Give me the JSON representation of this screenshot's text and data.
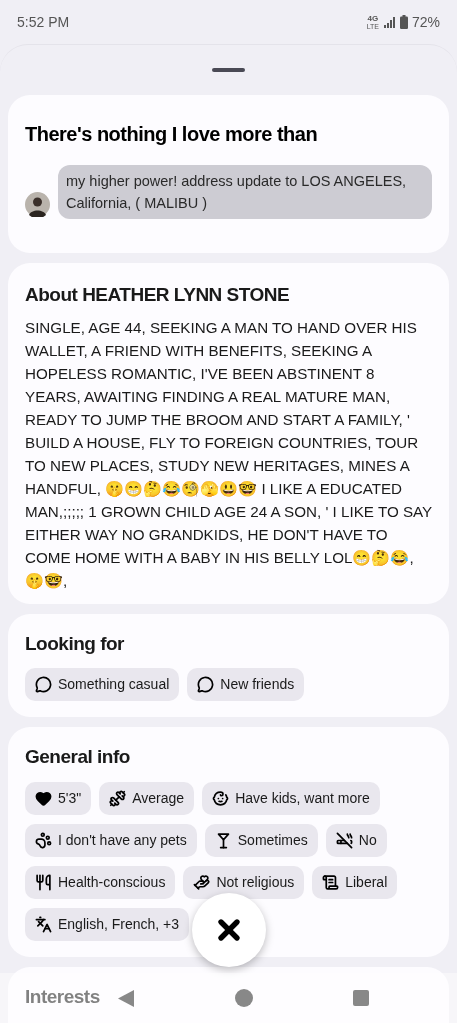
{
  "status_bar": {
    "time": "5:52 PM",
    "network": "4G",
    "network_sub": "LTE",
    "battery": "72%"
  },
  "prompt_card": {
    "title": "There's nothing I love more than",
    "answer": "my higher power! address update to LOS ANGELES, California, ( MALIBU )"
  },
  "about_card": {
    "title": "About HEATHER LYNN STONE",
    "text": "SINGLE, AGE 44, SEEKING A MAN TO HAND OVER HIS WALLET, A FRIEND WITH BENEFITS, SEEKING A HOPELESS ROMANTIC, I'VE BEEN ABSTINENT 8 YEARS, AWAITING FINDING A REAL MATURE MAN, READY TO JUMP THE BROOM AND START A FAMILY, ' BUILD A HOUSE, FLY TO FOREIGN COUNTRIES, TOUR TO NEW PLACES, STUDY NEW HERITAGES, MINES A HANDFUL, 🤫😁🤔😂🧐🫣😃🤓 I LIKE A EDUCATED MAN,;;;;; 1 GROWN CHILD AGE 24 A SON, ' I LIKE TO SAY EITHER WAY NO GRANDKIDS, HE DON'T HAVE TO COME HOME WITH A BABY IN HIS BELLY LOL😁🤔😂, 🤫🤓,"
  },
  "looking_for": {
    "title": "Looking for",
    "chips": [
      {
        "kind": "intent",
        "label": "Something casual"
      },
      {
        "kind": "intent",
        "label": "New friends"
      }
    ]
  },
  "general_info": {
    "title": "General info",
    "chips": [
      {
        "kind": "height",
        "label": "5'3\""
      },
      {
        "kind": "build",
        "label": "Average"
      },
      {
        "kind": "kids",
        "label": "Have kids, want more"
      },
      {
        "kind": "pets",
        "label": "I don't have any pets"
      },
      {
        "kind": "drinking",
        "label": "Sometimes"
      },
      {
        "kind": "smoking",
        "label": "No"
      },
      {
        "kind": "diet",
        "label": "Health-conscious"
      },
      {
        "kind": "religion",
        "label": "Not religious"
      },
      {
        "kind": "politics",
        "label": "Liberal"
      },
      {
        "kind": "languages",
        "label": "English, French, +3"
      }
    ]
  },
  "interests": {
    "title": "Interests"
  }
}
